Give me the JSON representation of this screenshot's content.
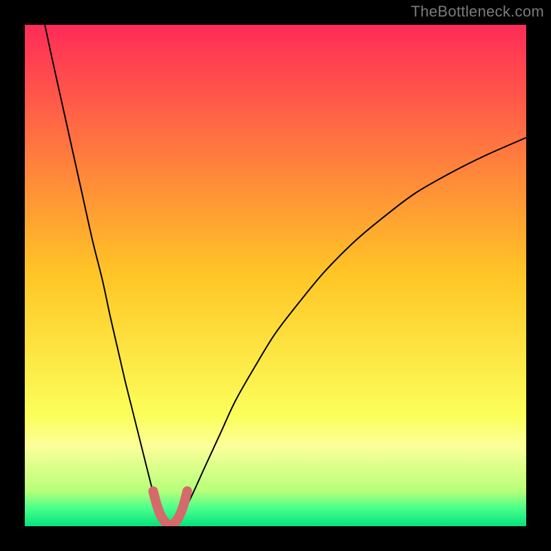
{
  "watermark": {
    "text": "TheBottleneck.com"
  },
  "chart_data": {
    "type": "line",
    "title": "",
    "xlabel": "",
    "ylabel": "",
    "xlim": [
      0,
      100
    ],
    "ylim": [
      0,
      100
    ],
    "grid": false,
    "legend": false,
    "background_gradient": {
      "stops": [
        {
          "offset": 0.0,
          "color": "#ff2b58"
        },
        {
          "offset": 0.5,
          "color": "#ffc626"
        },
        {
          "offset": 0.78,
          "color": "#fbff5a"
        },
        {
          "offset": 0.84,
          "color": "#fcff9a"
        },
        {
          "offset": 0.93,
          "color": "#b6ff7a"
        },
        {
          "offset": 0.965,
          "color": "#48ff8b"
        },
        {
          "offset": 1.0,
          "color": "#06e17c"
        }
      ]
    },
    "series": [
      {
        "name": "curve-left",
        "stroke": "#000000",
        "stroke_width": 2,
        "data": [
          {
            "x": 4.0,
            "y": 100.0
          },
          {
            "x": 5.5,
            "y": 93.0
          },
          {
            "x": 7.5,
            "y": 84.0
          },
          {
            "x": 9.5,
            "y": 75.0
          },
          {
            "x": 11.5,
            "y": 66.0
          },
          {
            "x": 13.5,
            "y": 57.0
          },
          {
            "x": 15.5,
            "y": 49.0
          },
          {
            "x": 17.0,
            "y": 42.0
          },
          {
            "x": 18.5,
            "y": 35.5
          },
          {
            "x": 20.0,
            "y": 29.0
          },
          {
            "x": 21.5,
            "y": 23.0
          },
          {
            "x": 23.0,
            "y": 17.0
          },
          {
            "x": 24.5,
            "y": 11.0
          },
          {
            "x": 25.8,
            "y": 6.0
          },
          {
            "x": 27.0,
            "y": 2.5
          },
          {
            "x": 28.0,
            "y": 0.8
          },
          {
            "x": 29.0,
            "y": 0.0
          }
        ]
      },
      {
        "name": "curve-right",
        "stroke": "#000000",
        "stroke_width": 2,
        "data": [
          {
            "x": 29.0,
            "y": 0.0
          },
          {
            "x": 30.0,
            "y": 0.7
          },
          {
            "x": 31.5,
            "y": 2.5
          },
          {
            "x": 33.5,
            "y": 6.5
          },
          {
            "x": 36.0,
            "y": 12.0
          },
          {
            "x": 39.0,
            "y": 18.5
          },
          {
            "x": 42.0,
            "y": 25.0
          },
          {
            "x": 46.0,
            "y": 32.0
          },
          {
            "x": 50.0,
            "y": 38.5
          },
          {
            "x": 55.0,
            "y": 45.0
          },
          {
            "x": 60.0,
            "y": 51.0
          },
          {
            "x": 66.0,
            "y": 57.0
          },
          {
            "x": 72.0,
            "y": 62.0
          },
          {
            "x": 78.0,
            "y": 66.5
          },
          {
            "x": 85.0,
            "y": 70.5
          },
          {
            "x": 92.0,
            "y": 74.0
          },
          {
            "x": 100.0,
            "y": 77.5
          }
        ]
      },
      {
        "name": "highlight-valley",
        "stroke": "#d46a6a",
        "stroke_width": 14,
        "linecap": "round",
        "data": [
          {
            "x": 25.6,
            "y": 7.0
          },
          {
            "x": 26.4,
            "y": 4.0
          },
          {
            "x": 27.3,
            "y": 1.8
          },
          {
            "x": 28.2,
            "y": 0.6
          },
          {
            "x": 29.0,
            "y": 0.2
          },
          {
            "x": 29.8,
            "y": 0.6
          },
          {
            "x": 30.7,
            "y": 1.8
          },
          {
            "x": 31.6,
            "y": 4.0
          },
          {
            "x": 32.4,
            "y": 7.0
          }
        ]
      }
    ]
  }
}
